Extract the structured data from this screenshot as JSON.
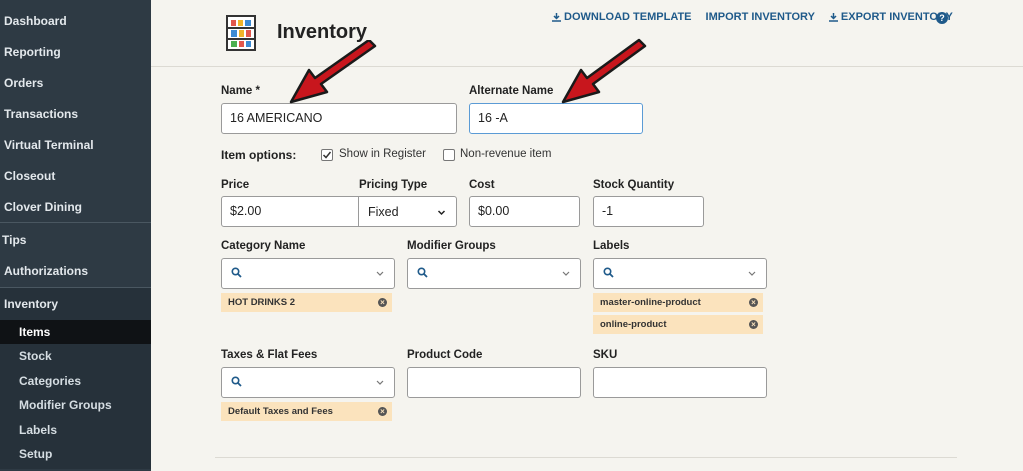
{
  "sidebar": {
    "items": [
      {
        "label": "Dashboard"
      },
      {
        "label": "Reporting"
      },
      {
        "label": "Orders"
      },
      {
        "label": "Transactions"
      },
      {
        "label": "Virtual Terminal"
      },
      {
        "label": "Closeout"
      },
      {
        "label": "Clover Dining"
      },
      {
        "label": "Tips"
      },
      {
        "label": "Authorizations"
      },
      {
        "label": "Inventory"
      }
    ],
    "inventory_sub": [
      {
        "label": "Items"
      },
      {
        "label": "Stock"
      },
      {
        "label": "Categories"
      },
      {
        "label": "Modifier Groups"
      },
      {
        "label": "Labels"
      },
      {
        "label": "Setup"
      }
    ]
  },
  "header": {
    "title": "Inventory",
    "links": {
      "download": "DOWNLOAD TEMPLATE",
      "import": "IMPORT INVENTORY",
      "export": "EXPORT INVENTORY"
    },
    "help": "?"
  },
  "form": {
    "name_label": "Name *",
    "name_value": "16 AMERICANO",
    "alt_label": "Alternate Name",
    "alt_value": "16 -A",
    "options_label": "Item options:",
    "show_in_register": "Show in Register",
    "show_in_register_checked": true,
    "non_revenue": "Non-revenue item",
    "non_revenue_checked": false,
    "price_label": "Price",
    "price_value": "$2.00",
    "pricing_type_label": "Pricing Type",
    "pricing_type_value": "Fixed",
    "cost_label": "Cost",
    "cost_value": "$0.00",
    "stock_label": "Stock Quantity",
    "stock_value": "-1",
    "category_label": "Category Name",
    "category_tags": [
      "HOT DRINKS 2"
    ],
    "modifier_label": "Modifier Groups",
    "labels_label": "Labels",
    "labels_tags": [
      "master-online-product",
      "online-product"
    ],
    "taxes_label": "Taxes & Flat Fees",
    "taxes_tags": [
      "Default Taxes and Fees"
    ],
    "product_code_label": "Product Code",
    "product_code_value": "",
    "sku_label": "SKU",
    "sku_value": ""
  },
  "colors": {
    "sidebar_bg": "#2e3a44",
    "link_blue": "#1f5a8a",
    "tag_bg": "#fbe3bd",
    "arrow_red": "#c8161d"
  }
}
